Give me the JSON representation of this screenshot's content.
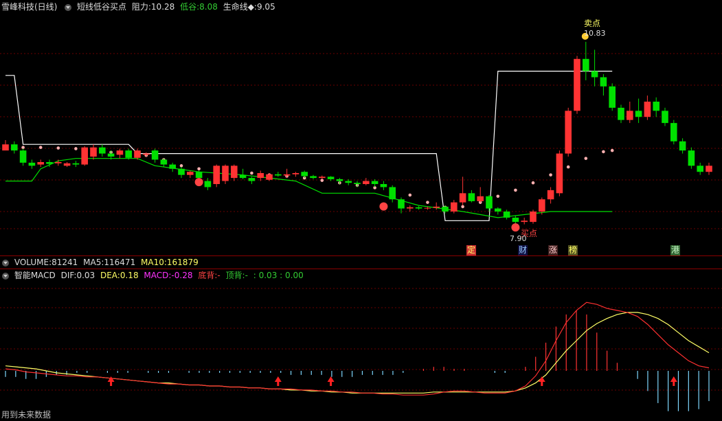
{
  "header": {
    "stock": "雪峰科技(日线)",
    "indicator": "短线低谷买点",
    "resist_label": "阻力:",
    "resist_value": "10.28",
    "valley_label": "低谷:",
    "valley_value": "8.08",
    "life_label": "生命线◆:",
    "life_value": "9.05"
  },
  "volume_bar": {
    "label": "VOLUME:",
    "value": "81241",
    "ma5_label": "MA5:",
    "ma5_value": "116471",
    "ma10_label": "MA10:",
    "ma10_value": "161879"
  },
  "macd_bar": {
    "label": "智能MACD",
    "dif_label": "DIF:",
    "dif_value": "0.03",
    "dea_label": "DEA:",
    "dea_value": "0.18",
    "macd_label": "MACD:",
    "macd_value": "-0.28",
    "bottom_label": "底背:",
    "bottom_value": "-",
    "top_label": "顶背:",
    "top_value": "-",
    "extra": ": 0.03 : 0.00"
  },
  "annotations": {
    "sell_point": "卖点",
    "high_price": "10.83",
    "buy_point": "买点",
    "low_price": "7.90",
    "events": [
      "定",
      "财",
      "涨",
      "榜",
      "港"
    ],
    "footer": "用到未来数据"
  },
  "colors": {
    "up": "#ff3333",
    "down": "#00e000",
    "white_line": "#ffffff",
    "dots": "#ffb0b0",
    "dif": "#ff3030",
    "dea": "#ffff66"
  },
  "chart_data": [
    {
      "type": "candlestick",
      "title": "短线低谷买点",
      "ylim": [
        7.6,
        11.2
      ],
      "candles": [
        [
          9.05,
          9.15,
          9.08,
          9.22
        ],
        [
          9.15,
          9.05,
          9.0,
          9.2
        ],
        [
          9.05,
          8.85,
          8.8,
          9.08
        ],
        [
          8.85,
          8.8,
          8.75,
          8.9
        ],
        [
          8.82,
          8.86,
          8.78,
          8.9
        ],
        [
          8.86,
          8.83,
          8.78,
          8.9
        ],
        [
          8.84,
          8.86,
          8.8,
          8.9
        ],
        [
          8.8,
          8.84,
          8.78,
          8.86
        ],
        [
          8.84,
          8.82,
          8.78,
          8.88
        ],
        [
          8.82,
          9.1,
          8.8,
          9.12
        ],
        [
          8.95,
          9.1,
          8.9,
          9.15
        ],
        [
          9.1,
          9.0,
          8.95,
          9.15
        ],
        [
          9.0,
          8.95,
          8.9,
          9.05
        ],
        [
          8.98,
          9.05,
          8.92,
          9.08
        ],
        [
          9.05,
          8.93,
          8.9,
          9.08
        ],
        [
          8.93,
          9.05,
          8.9,
          9.08
        ],
        [
          8.98,
          9.0,
          8.95,
          9.02
        ],
        [
          9.05,
          8.9,
          8.85,
          9.08
        ],
        [
          8.9,
          8.82,
          8.78,
          8.92
        ],
        [
          8.82,
          8.75,
          8.7,
          8.85
        ],
        [
          8.75,
          8.65,
          8.6,
          8.78
        ],
        [
          8.65,
          8.7,
          8.6,
          8.72
        ],
        [
          8.7,
          8.6,
          8.55,
          8.72
        ],
        [
          8.55,
          8.45,
          8.4,
          8.6
        ],
        [
          8.5,
          8.8,
          8.45,
          8.82
        ],
        [
          8.55,
          8.8,
          8.5,
          8.82
        ],
        [
          8.6,
          8.8,
          8.55,
          8.82
        ],
        [
          8.65,
          8.6,
          8.58,
          8.75
        ],
        [
          8.6,
          8.55,
          8.5,
          8.62
        ],
        [
          8.6,
          8.68,
          8.55,
          8.72
        ],
        [
          8.57,
          8.66,
          8.55,
          8.68
        ],
        [
          8.66,
          8.64,
          8.62,
          8.7
        ],
        [
          8.64,
          8.66,
          8.6,
          8.75
        ],
        [
          8.66,
          8.68,
          8.62,
          8.7
        ],
        [
          8.7,
          8.63,
          8.6,
          8.72
        ],
        [
          8.63,
          8.6,
          8.58,
          8.65
        ],
        [
          8.6,
          8.62,
          8.58,
          8.64
        ],
        [
          8.62,
          8.58,
          8.55,
          8.63
        ],
        [
          8.58,
          8.55,
          8.5,
          8.6
        ],
        [
          8.55,
          8.52,
          8.48,
          8.58
        ],
        [
          8.52,
          8.5,
          8.45,
          8.55
        ],
        [
          8.5,
          8.55,
          8.48,
          8.6
        ],
        [
          8.55,
          8.5,
          8.45,
          8.58
        ],
        [
          8.5,
          8.45,
          8.4,
          8.55
        ],
        [
          8.45,
          8.25,
          8.2,
          8.48
        ],
        [
          8.25,
          8.1,
          8.02,
          8.28
        ],
        [
          8.1,
          8.12,
          8.05,
          8.15
        ],
        [
          8.12,
          8.1,
          8.08,
          8.14
        ],
        [
          8.1,
          8.11,
          8.08,
          8.13
        ],
        [
          8.11,
          8.13,
          8.08,
          8.2
        ],
        [
          8.13,
          8.05,
          8.02,
          8.15
        ],
        [
          8.05,
          8.2,
          8.02,
          8.24
        ],
        [
          8.2,
          8.35,
          8.15,
          8.62
        ],
        [
          8.35,
          8.22,
          8.2,
          8.4
        ],
        [
          8.22,
          8.3,
          8.2,
          8.45
        ],
        [
          8.3,
          8.1,
          8.05,
          8.32
        ],
        [
          8.1,
          8.05,
          8.0,
          8.12
        ],
        [
          8.05,
          7.95,
          7.92,
          8.08
        ],
        [
          7.95,
          7.88,
          7.85,
          7.98
        ],
        [
          7.88,
          7.9,
          7.84,
          7.95
        ],
        [
          7.88,
          8.05,
          7.85,
          8.08
        ],
        [
          8.05,
          8.25,
          8.0,
          8.28
        ],
        [
          8.25,
          8.4,
          8.18,
          8.45
        ],
        [
          8.35,
          9.0,
          8.3,
          9.05
        ],
        [
          9.0,
          9.7,
          8.95,
          9.75
        ],
        [
          9.7,
          10.55,
          9.65,
          10.6
        ],
        [
          10.55,
          10.35,
          10.2,
          10.83
        ],
        [
          10.35,
          10.25,
          10.1,
          10.7
        ],
        [
          10.25,
          10.1,
          9.95,
          10.3
        ],
        [
          10.1,
          9.75,
          9.7,
          10.15
        ],
        [
          9.75,
          9.55,
          9.5,
          9.8
        ],
        [
          9.55,
          9.7,
          9.5,
          9.85
        ],
        [
          9.7,
          9.6,
          9.5,
          9.9
        ],
        [
          9.6,
          9.85,
          9.55,
          9.95
        ],
        [
          9.85,
          9.7,
          9.6,
          9.92
        ],
        [
          9.7,
          9.5,
          9.45,
          9.75
        ],
        [
          9.5,
          9.2,
          9.15,
          9.55
        ],
        [
          9.2,
          9.05,
          9.0,
          9.25
        ],
        [
          9.05,
          8.8,
          8.75,
          9.1
        ],
        [
          8.8,
          8.7,
          8.65,
          8.85
        ],
        [
          8.7,
          8.8,
          8.65,
          8.85
        ]
      ],
      "resistance_line": [
        [
          0,
          10.28
        ],
        [
          1,
          10.28
        ],
        [
          2,
          9.15
        ],
        [
          14,
          9.15
        ],
        [
          15,
          9.0
        ],
        [
          49,
          9.0
        ],
        [
          50,
          7.9
        ],
        [
          55,
          7.9
        ],
        [
          56,
          10.35
        ],
        [
          69,
          10.35
        ]
      ],
      "life_line": [
        [
          0,
          8.55
        ],
        [
          3,
          8.55
        ],
        [
          4,
          8.75
        ],
        [
          6,
          8.88
        ],
        [
          8,
          8.92
        ],
        [
          15,
          8.92
        ],
        [
          17,
          8.8
        ],
        [
          22,
          8.7
        ],
        [
          27,
          8.65
        ],
        [
          33,
          8.55
        ],
        [
          36,
          8.35
        ],
        [
          42,
          8.35
        ],
        [
          47,
          8.15
        ],
        [
          52,
          8.05
        ],
        [
          56,
          7.95
        ],
        [
          62,
          8.05
        ],
        [
          69,
          8.05
        ]
      ],
      "pink_dots": [
        [
          2,
          9.1
        ],
        [
          4,
          9.1
        ],
        [
          6,
          9.09
        ],
        [
          8,
          9.08
        ],
        [
          10,
          9.05
        ],
        [
          12,
          9.02
        ],
        [
          14,
          9.0
        ],
        [
          16,
          8.97
        ],
        [
          18,
          8.9
        ],
        [
          20,
          8.8
        ],
        [
          22,
          8.75
        ],
        [
          24,
          8.72
        ],
        [
          26,
          8.7
        ],
        [
          28,
          8.68
        ],
        [
          30,
          8.65
        ],
        [
          32,
          8.63
        ],
        [
          34,
          8.6
        ],
        [
          36,
          8.56
        ],
        [
          38,
          8.52
        ],
        [
          40,
          8.48
        ],
        [
          42,
          8.44
        ],
        [
          44,
          8.4
        ],
        [
          46,
          8.32
        ],
        [
          48,
          8.2
        ],
        [
          50,
          8.12
        ],
        [
          51,
          8.1
        ],
        [
          52,
          8.13
        ],
        [
          54,
          8.2
        ],
        [
          56,
          8.3
        ],
        [
          58,
          8.4
        ],
        [
          60,
          8.52
        ],
        [
          62,
          8.65
        ],
        [
          64,
          8.78
        ],
        [
          66,
          8.92
        ],
        [
          68,
          9.03
        ],
        [
          69,
          9.05
        ]
      ]
    },
    {
      "type": "line+bar",
      "title": "智能MACD",
      "series": [
        {
          "name": "DIF",
          "values": [
            0.02,
            0.01,
            -0.01,
            -0.02,
            -0.03,
            -0.04,
            -0.05,
            -0.05,
            -0.06,
            -0.06,
            -0.07,
            -0.08,
            -0.09,
            -0.1,
            -0.11,
            -0.12,
            -0.13,
            -0.13,
            -0.14,
            -0.14,
            -0.15,
            -0.15,
            -0.16,
            -0.16,
            -0.17,
            -0.17,
            -0.18,
            -0.18,
            -0.18,
            -0.19,
            -0.19,
            -0.2,
            -0.2,
            -0.21,
            -0.21,
            -0.22,
            -0.22,
            -0.23,
            -0.23,
            -0.24,
            -0.24,
            -0.24,
            -0.23,
            -0.21,
            -0.2,
            -0.2,
            -0.21,
            -0.22,
            -0.22,
            -0.22,
            -0.2,
            -0.15,
            -0.05,
            0.1,
            0.3,
            0.48,
            0.6,
            0.68,
            0.66,
            0.62,
            0.6,
            0.58,
            0.54,
            0.46,
            0.36,
            0.26,
            0.18,
            0.1,
            0.05,
            0.03
          ]
        },
        {
          "name": "DEA",
          "values": [
            0.05,
            0.04,
            0.03,
            0.02,
            0.0,
            -0.02,
            -0.03,
            -0.04,
            -0.05,
            -0.06,
            -0.07,
            -0.08,
            -0.09,
            -0.1,
            -0.11,
            -0.12,
            -0.12,
            -0.13,
            -0.14,
            -0.14,
            -0.15,
            -0.15,
            -0.16,
            -0.16,
            -0.17,
            -0.17,
            -0.18,
            -0.18,
            -0.19,
            -0.19,
            -0.2,
            -0.2,
            -0.21,
            -0.21,
            -0.22,
            -0.22,
            -0.22,
            -0.22,
            -0.22,
            -0.22,
            -0.22,
            -0.22,
            -0.21,
            -0.21,
            -0.21,
            -0.21,
            -0.21,
            -0.21,
            -0.21,
            -0.21,
            -0.2,
            -0.17,
            -0.12,
            -0.04,
            0.08,
            0.2,
            0.3,
            0.4,
            0.47,
            0.52,
            0.56,
            0.58,
            0.58,
            0.56,
            0.52,
            0.46,
            0.38,
            0.3,
            0.24,
            0.18
          ]
        },
        {
          "name": "MACD",
          "values": [
            -0.06,
            -0.06,
            -0.08,
            -0.08,
            -0.06,
            -0.04,
            -0.04,
            -0.02,
            -0.02,
            0.0,
            -0.02,
            -0.02,
            -0.02,
            0.0,
            -0.02,
            -0.02,
            -0.02,
            0.0,
            -0.02,
            -0.02,
            -0.02,
            -0.02,
            -0.02,
            -0.02,
            -0.02,
            -0.02,
            -0.02,
            -0.02,
            -0.04,
            -0.04,
            -0.04,
            -0.04,
            -0.06,
            -0.06,
            -0.06,
            -0.04,
            -0.04,
            -0.04,
            -0.04,
            -0.02,
            0.0,
            0.02,
            0.04,
            0.04,
            0.02,
            0.02,
            0.0,
            0.0,
            -0.02,
            -0.02,
            0.0,
            0.04,
            0.14,
            0.28,
            0.44,
            0.56,
            0.6,
            0.56,
            0.38,
            0.2,
            0.08,
            0.0,
            -0.08,
            -0.2,
            -0.32,
            -0.4,
            -0.4,
            -0.4,
            -0.38,
            -0.3
          ]
        }
      ],
      "signal_arrows": [
        12,
        31,
        37,
        61,
        76
      ],
      "ylim": [
        -0.5,
        0.75
      ]
    }
  ]
}
